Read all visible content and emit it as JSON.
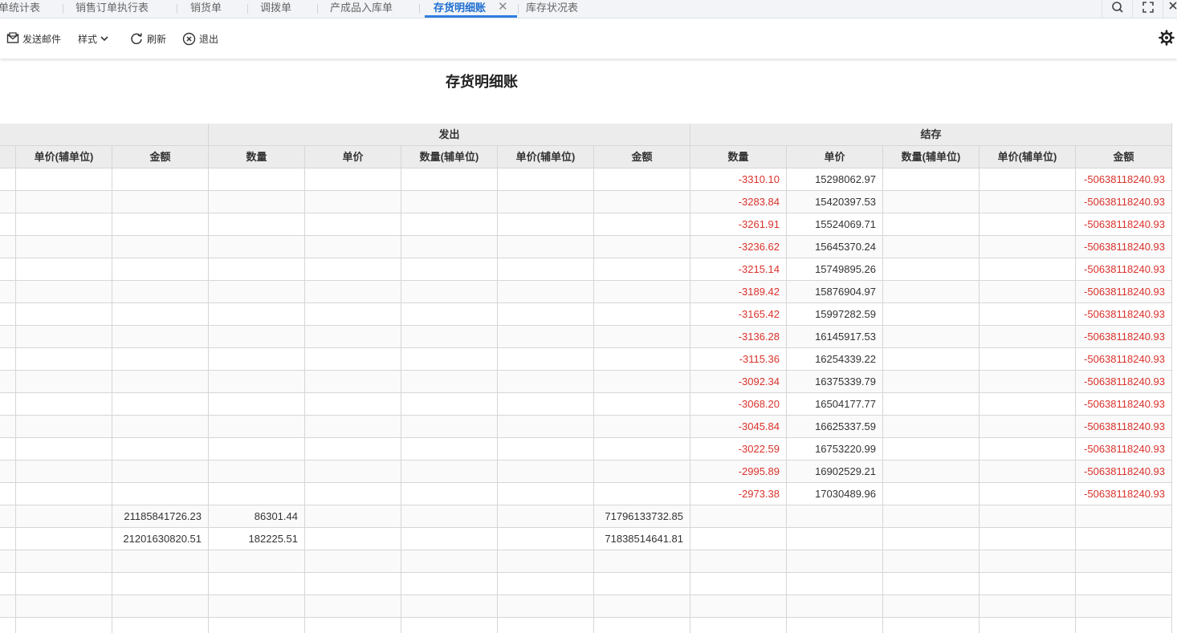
{
  "tabs": [
    {
      "label": "单统计表",
      "active": false
    },
    {
      "label": "销售订单执行表",
      "active": false
    },
    {
      "label": "销货单",
      "active": false
    },
    {
      "label": "调拨单",
      "active": false
    },
    {
      "label": "产成品入库单",
      "active": false
    },
    {
      "label": "存货明细账",
      "active": true
    },
    {
      "label": "库存状况表",
      "active": false
    }
  ],
  "toolbar": {
    "email_label": "发送邮件",
    "style_label": "样式",
    "refresh_label": "刷新",
    "exit_label": "退出"
  },
  "report": {
    "title": "存货明细账"
  },
  "table": {
    "groups": {
      "issue": "发出",
      "balance": "结存"
    },
    "columns": [
      "单价(辅单位)",
      "金额",
      "数量",
      "单价",
      "数量(辅单位)",
      "单价(辅单位)",
      "金额",
      "数量",
      "单价",
      "数量(辅单位)",
      "单价(辅单位)",
      "金额"
    ],
    "rows": [
      [
        "",
        "",
        "",
        "",
        "",
        "",
        "",
        "-3310.10",
        "15298062.97",
        "",
        "",
        "-50638118240.93"
      ],
      [
        "",
        "",
        "",
        "",
        "",
        "",
        "",
        "-3283.84",
        "15420397.53",
        "",
        "",
        "-50638118240.93"
      ],
      [
        "",
        "",
        "",
        "",
        "",
        "",
        "",
        "-3261.91",
        "15524069.71",
        "",
        "",
        "-50638118240.93"
      ],
      [
        "",
        "",
        "",
        "",
        "",
        "",
        "",
        "-3236.62",
        "15645370.24",
        "",
        "",
        "-50638118240.93"
      ],
      [
        "",
        "",
        "",
        "",
        "",
        "",
        "",
        "-3215.14",
        "15749895.26",
        "",
        "",
        "-50638118240.93"
      ],
      [
        "",
        "",
        "",
        "",
        "",
        "",
        "",
        "-3189.42",
        "15876904.97",
        "",
        "",
        "-50638118240.93"
      ],
      [
        "",
        "",
        "",
        "",
        "",
        "",
        "",
        "-3165.42",
        "15997282.59",
        "",
        "",
        "-50638118240.93"
      ],
      [
        "",
        "",
        "",
        "",
        "",
        "",
        "",
        "-3136.28",
        "16145917.53",
        "",
        "",
        "-50638118240.93"
      ],
      [
        "",
        "",
        "",
        "",
        "",
        "",
        "",
        "-3115.36",
        "16254339.22",
        "",
        "",
        "-50638118240.93"
      ],
      [
        "",
        "",
        "",
        "",
        "",
        "",
        "",
        "-3092.34",
        "16375339.79",
        "",
        "",
        "-50638118240.93"
      ],
      [
        "",
        "",
        "",
        "",
        "",
        "",
        "",
        "-3068.20",
        "16504177.77",
        "",
        "",
        "-50638118240.93"
      ],
      [
        "",
        "",
        "",
        "",
        "",
        "",
        "",
        "-3045.84",
        "16625337.59",
        "",
        "",
        "-50638118240.93"
      ],
      [
        "",
        "",
        "",
        "",
        "",
        "",
        "",
        "-3022.59",
        "16753220.99",
        "",
        "",
        "-50638118240.93"
      ],
      [
        "",
        "",
        "",
        "",
        "",
        "",
        "",
        "-2995.89",
        "16902529.21",
        "",
        "",
        "-50638118240.93"
      ],
      [
        "",
        "",
        "",
        "",
        "",
        "",
        "",
        "-2973.38",
        "17030489.96",
        "",
        "",
        "-50638118240.93"
      ],
      [
        "",
        "21185841726.23",
        "86301.44",
        "",
        "",
        "",
        "71796133732.85",
        "",
        "",
        "",
        "",
        ""
      ],
      [
        "",
        "21201630820.51",
        "182225.51",
        "",
        "",
        "",
        "71838514641.81",
        "",
        "",
        "",
        "",
        ""
      ],
      [
        "",
        "",
        "",
        "",
        "",
        "",
        "",
        "",
        "",
        "",
        "",
        ""
      ],
      [
        "",
        "",
        "",
        "",
        "",
        "",
        "",
        "",
        "",
        "",
        "",
        ""
      ],
      [
        "",
        "",
        "",
        "",
        "",
        "",
        "",
        "",
        "",
        "",
        "",
        ""
      ],
      [
        "",
        "",
        "",
        "",
        "",
        "",
        "",
        "",
        "",
        "",
        "",
        ""
      ]
    ]
  },
  "colors": {
    "accent": "#2f7de1",
    "negative": "#d9322b",
    "header_bg": "#ececec"
  },
  "icons": [
    "envelope-icon",
    "chevron-down-icon",
    "refresh-icon",
    "close-circle-icon",
    "search-icon",
    "fullscreen-icon",
    "close-icon",
    "gear-icon"
  ]
}
